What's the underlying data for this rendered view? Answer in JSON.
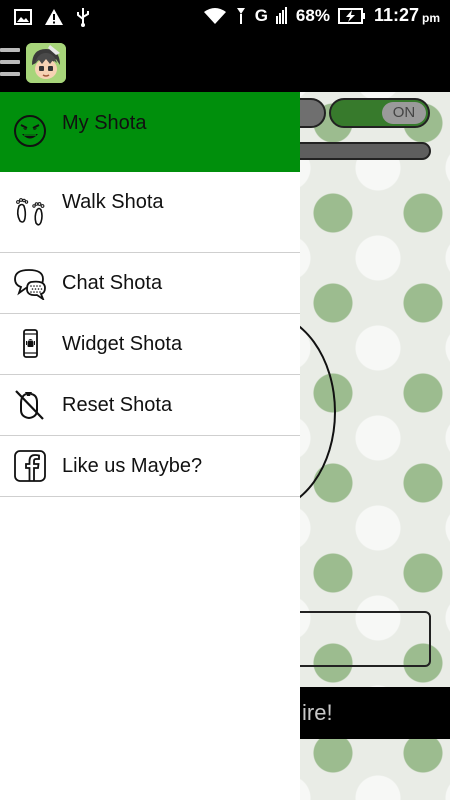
{
  "status_bar": {
    "network": "G",
    "battery": "68%",
    "time": "11:27",
    "ampm": "pm"
  },
  "background": {
    "toggle_label": "ON",
    "bar_text": "ire!"
  },
  "drawer": {
    "items": [
      {
        "label": "My Shota",
        "icon": "devil-face-icon"
      },
      {
        "label": "Walk Shota",
        "icon": "footprints-icon"
      },
      {
        "label": "Chat Shota",
        "icon": "chat-bubbles-icon"
      },
      {
        "label": "Widget Shota",
        "icon": "phone-widget-icon"
      },
      {
        "label": "Reset Shota",
        "icon": "reset-slashed-icon"
      },
      {
        "label": "Like us Maybe?",
        "icon": "facebook-icon"
      }
    ],
    "header_color": "#008f0c"
  }
}
